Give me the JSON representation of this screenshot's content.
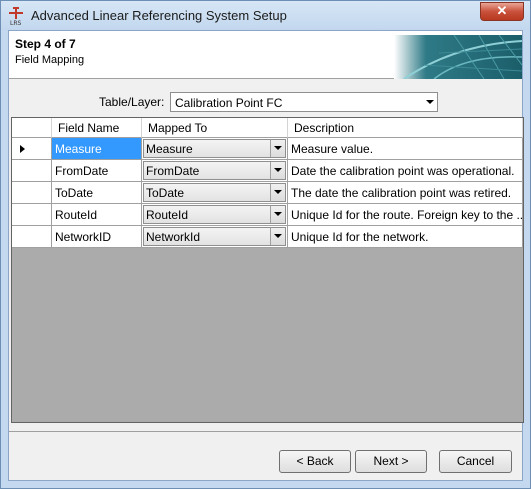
{
  "window": {
    "title": "Advanced Linear Referencing System Setup",
    "close_label": "✕"
  },
  "header": {
    "step": "Step 4 of 7",
    "subtitle": "Field Mapping"
  },
  "table_layer": {
    "label": "Table/Layer:",
    "value": "Calibration Point FC"
  },
  "grid": {
    "columns": [
      "Field Name",
      "Mapped To",
      "Description"
    ],
    "rows": [
      {
        "field": "Measure",
        "mapped": "Measure",
        "desc": "Measure value."
      },
      {
        "field": "FromDate",
        "mapped": "FromDate",
        "desc": "Date the calibration point was operational."
      },
      {
        "field": "ToDate",
        "mapped": "ToDate",
        "desc": "The date the calibration point was retired."
      },
      {
        "field": "RouteId",
        "mapped": "RouteId",
        "desc": "Unique Id for the route. Foreign key to the ..."
      },
      {
        "field": "NetworkID",
        "mapped": "NetworkId",
        "desc": "Unique Id for the network."
      }
    ]
  },
  "buttons": {
    "back": "< Back",
    "next": "Next >",
    "cancel": "Cancel"
  }
}
